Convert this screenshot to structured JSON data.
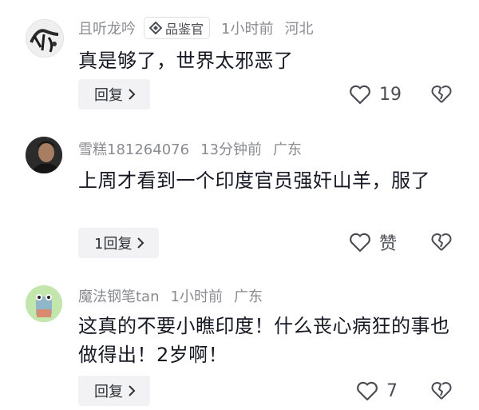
{
  "comments": [
    {
      "username": "且听龙吟",
      "badge": "品鉴官",
      "time": "1小时前",
      "location": "河北",
      "text": "真是够了，世界太邪恶了",
      "reply_label": "回复",
      "likes": "19",
      "avatar": "ink-calligraphy-avatar"
    },
    {
      "username": "雪糕181264076",
      "time": "13分钟前",
      "location": "广东",
      "text": "上周才看到一个印度官员强奸山羊，服了",
      "reply_label": "1回复",
      "likes": "赞",
      "avatar": "man-photo-avatar"
    },
    {
      "username": "魔法钢笔tan",
      "time": "1小时前",
      "location": "广东",
      "text": "这真的不要小瞧印度！什么丧心病狂的事也做得出！2岁啊！",
      "reply_label": "回复",
      "likes": "7",
      "avatar": "cartoon-character-avatar"
    }
  ],
  "icons": {
    "like": "heart-outline-icon",
    "dislike": "broken-heart-icon",
    "reply_arrow": "chevron-right-icon",
    "badge": "diamond-badge-icon"
  },
  "colors": {
    "meta_gray": "#8a8b91",
    "text": "#161823",
    "button_bg": "#f2f2f4"
  }
}
